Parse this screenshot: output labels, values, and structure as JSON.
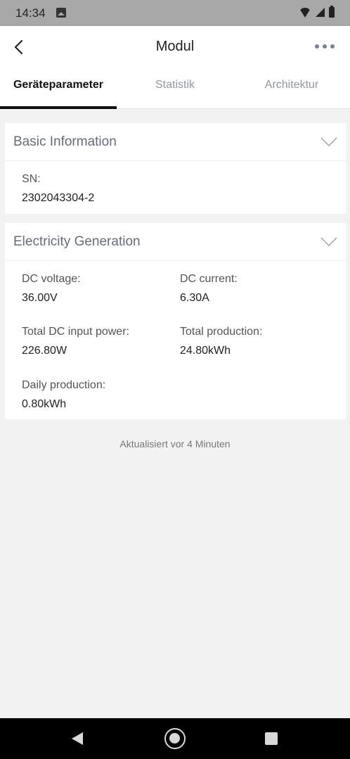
{
  "status_bar": {
    "time": "14:34"
  },
  "header": {
    "title": "Modul"
  },
  "tabs": [
    {
      "label": "Geräteparameter",
      "active": true
    },
    {
      "label": "Statistik",
      "active": false
    },
    {
      "label": "Architektur",
      "active": false
    }
  ],
  "basic_information": {
    "title": "Basic Information",
    "sn_label": "SN:",
    "sn_value": "2302043304-2"
  },
  "electricity_generation": {
    "title": "Electricity Generation",
    "dc_voltage_label": "DC voltage:",
    "dc_voltage_value": "36.00V",
    "dc_current_label": "DC current:",
    "dc_current_value": "6.30A",
    "total_dc_input_power_label": "Total DC input power:",
    "total_dc_input_power_value": "226.80W",
    "total_production_label": "Total production:",
    "total_production_value": "24.80kWh",
    "daily_production_label": "Daily production:",
    "daily_production_value": "0.80kWh"
  },
  "footer": {
    "updated_text": "Aktualisiert vor 4 Minuten"
  },
  "colors": {
    "accent": "#111111",
    "card_title": "#666b80",
    "tab_inactive": "#9095a8",
    "background": "#f2f2f2"
  }
}
